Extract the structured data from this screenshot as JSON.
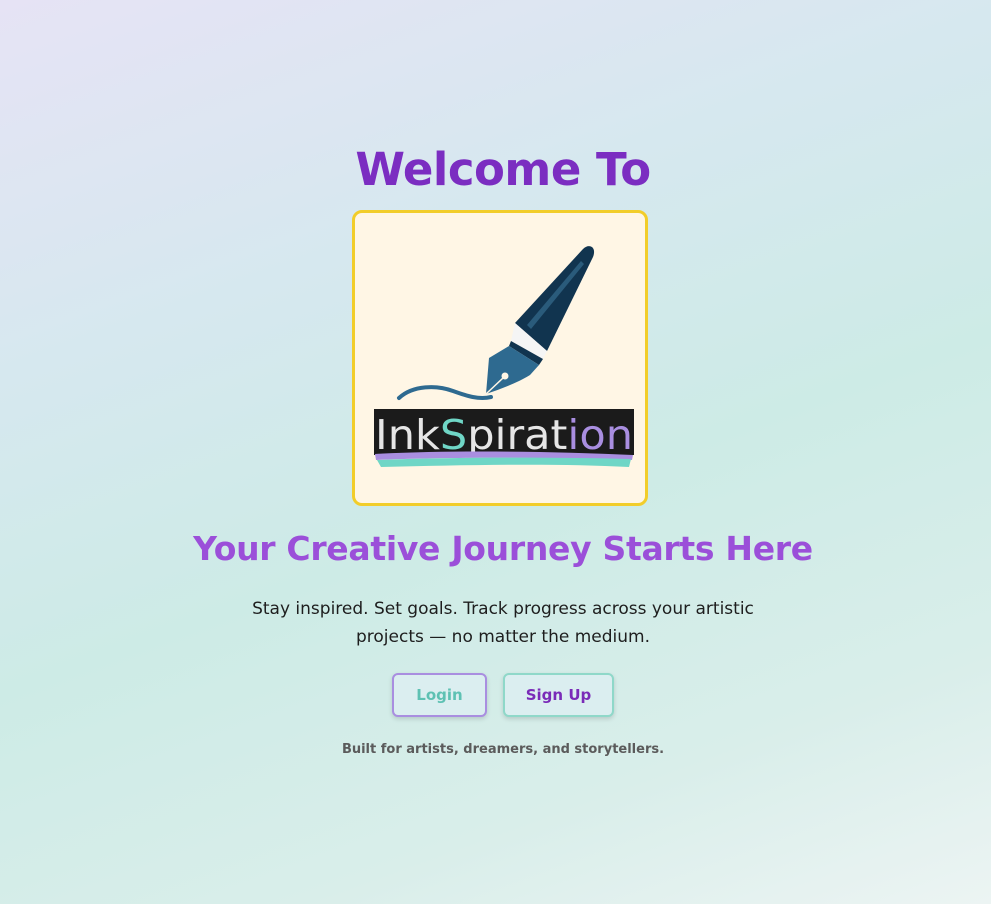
{
  "hero": {
    "welcome": "Welcome To",
    "logo_text_parts": [
      "Ink",
      "S",
      "pirat",
      "ion"
    ],
    "tagline": "Your Creative Journey Starts Here",
    "description": "Stay inspired. Set goals. Track progress across your artistic projects — no matter the medium."
  },
  "actions": {
    "login_label": "Login",
    "signup_label": "Sign Up"
  },
  "footer": {
    "text": "Built for artists, dreamers, and storytellers."
  },
  "colors": {
    "welcome": "#7b2dc1",
    "tagline": "#9b4fd9",
    "card_border": "#f2cd2a",
    "card_bg": "#fff6e5",
    "teal": "#6fd6c6",
    "lavender": "#a98ee0",
    "pen_dark": "#11344f",
    "pen_mid": "#2e6a90"
  },
  "icons": {
    "logo": "fountain-pen-icon"
  }
}
